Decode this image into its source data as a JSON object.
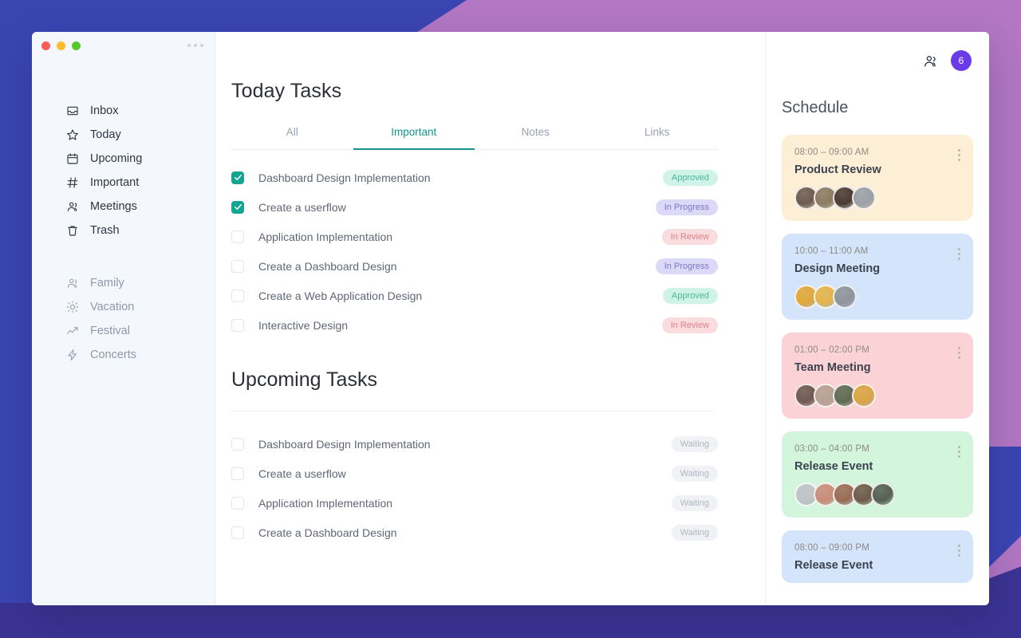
{
  "background": {
    "color_left": "#3B45B2",
    "color_right": "#B377C4",
    "color_bottom": "#3B3493"
  },
  "window": {
    "traffic_lights": [
      "close-red",
      "minimize-yellow",
      "maximize-green"
    ],
    "overflow_menu": "more-horizontal-icon"
  },
  "sidebar": {
    "primary_items": [
      {
        "label": "Inbox",
        "icon": "inbox-icon"
      },
      {
        "label": "Today",
        "icon": "star-icon"
      },
      {
        "label": "Upcoming",
        "icon": "calendar-icon"
      },
      {
        "label": "Important",
        "icon": "hash-icon"
      },
      {
        "label": "Meetings",
        "icon": "users-icon"
      },
      {
        "label": "Trash",
        "icon": "trash-icon"
      }
    ],
    "secondary_items": [
      {
        "label": "Family",
        "icon": "users-icon"
      },
      {
        "label": "Vacation",
        "icon": "sun-icon"
      },
      {
        "label": "Festival",
        "icon": "trending-up-icon"
      },
      {
        "label": "Concerts",
        "icon": "bolt-icon"
      }
    ]
  },
  "main": {
    "title": "Today Tasks",
    "tabs": [
      {
        "label": "All",
        "active": false
      },
      {
        "label": "Important",
        "active": true
      },
      {
        "label": "Notes",
        "active": false
      },
      {
        "label": "Links",
        "active": false
      }
    ],
    "active_tab_color": "#12958A",
    "today_tasks": [
      {
        "label": "Dashboard Design Implementation",
        "checked": true,
        "status": "Approved",
        "status_kind": "approved"
      },
      {
        "label": "Create a userflow",
        "checked": true,
        "status": "In Progress",
        "status_kind": "inprogress"
      },
      {
        "label": "Application Implementation",
        "checked": false,
        "status": "In Review",
        "status_kind": "inreview"
      },
      {
        "label": "Create a Dashboard Design",
        "checked": false,
        "status": "In Progress",
        "status_kind": "inprogress"
      },
      {
        "label": "Create a Web Application Design",
        "checked": false,
        "status": "Approved",
        "status_kind": "approved"
      },
      {
        "label": "Interactive Design",
        "checked": false,
        "status": "In Review",
        "status_kind": "inreview"
      }
    ],
    "upcoming_title": "Upcoming Tasks",
    "upcoming_tasks": [
      {
        "label": "Dashboard Design Implementation",
        "checked": false,
        "status": "Waiting",
        "status_kind": "waiting"
      },
      {
        "label": "Create a userflow",
        "checked": false,
        "status": "Waiting",
        "status_kind": "waiting"
      },
      {
        "label": "Application Implementation",
        "checked": false,
        "status": "Waiting",
        "status_kind": "waiting"
      },
      {
        "label": "Create a Dashboard Design",
        "checked": false,
        "status": "Waiting",
        "status_kind": "waiting"
      }
    ]
  },
  "schedule": {
    "title": "Schedule",
    "people_icon": "users-icon",
    "member_count": "6",
    "count_badge_color": "#6C3BE8",
    "events": [
      {
        "time": "08:00 – 09:00 AM",
        "title": "Product Review",
        "color": "#FCEFD5",
        "avatars": [
          "#6E5A52",
          "#8C7A63",
          "#4A3B33",
          "#9AA0A6"
        ]
      },
      {
        "time": "10:00 – 11:00 AM",
        "title": "Design Meeting",
        "color": "#D3E4FB",
        "avatars": [
          "#E0A73A",
          "#E3B44C",
          "#8F9499"
        ]
      },
      {
        "time": "01:00 – 02:00 PM",
        "title": "Team Meeting",
        "color": "#FBD3D6",
        "avatars": [
          "#6E5A52",
          "#B6A193",
          "#5E6B52",
          "#D9A545"
        ]
      },
      {
        "time": "03:00 – 04:00 PM",
        "title": "Release Event",
        "color": "#D2F5DC",
        "avatars": [
          "#BFC3C7",
          "#C98C7A",
          "#9B6B56",
          "#6F5A4A",
          "#566052"
        ]
      },
      {
        "time": "08:00 – 09:00 PM",
        "title": "Release Event",
        "color": "#D3E4FB",
        "avatars": []
      }
    ]
  }
}
